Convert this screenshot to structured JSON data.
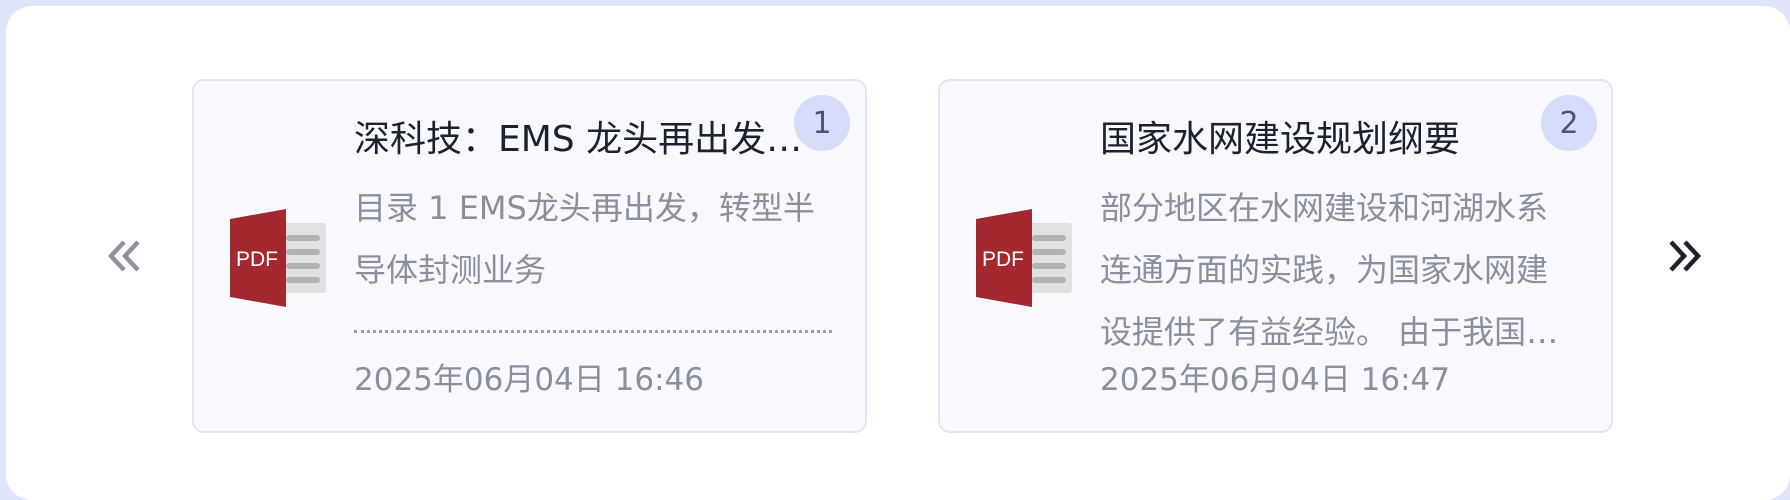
{
  "carousel": {
    "prev_icon": "double-chevron-left-icon",
    "next_icon": "double-chevron-right-icon",
    "prev_color": "#8e929c",
    "next_color": "#1d2129"
  },
  "cards": [
    {
      "badge": "1",
      "icon": "pdf-file-icon",
      "title": "深科技：EMS 龙头再出发，转型半导体封测业务",
      "description": "目录 1 EMS龙头再出发，转型半导体封测业务",
      "date": "2025年06月04日 16:46"
    },
    {
      "badge": "2",
      "icon": "pdf-file-icon",
      "title": "国家水网建设规划纲要",
      "description": "部分地区在水网建设和河湖水系连通方面的实践，为国家水网建设提供了有益经验。 由于我国水网建设",
      "date": "2025年06月04日 16:47"
    }
  ],
  "colors": {
    "pdf_red": "#a3282f",
    "badge_bg": "#d7dcfb",
    "card_bg": "#f8f9fe"
  }
}
